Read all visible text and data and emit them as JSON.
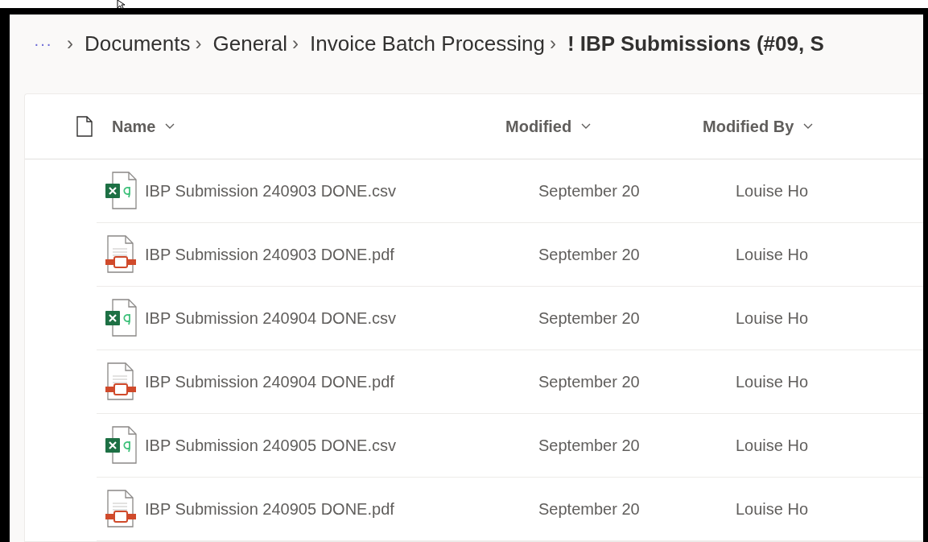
{
  "breadcrumb": {
    "overflow": "···",
    "separator": "›",
    "items": [
      {
        "label": "Documents",
        "current": false
      },
      {
        "label": "General",
        "current": false
      },
      {
        "label": "Invoice Batch Processing",
        "current": false
      },
      {
        "label": "! IBP Submissions (#09, S",
        "current": true
      }
    ]
  },
  "table": {
    "columns": [
      {
        "label": "Name"
      },
      {
        "label": "Modified"
      },
      {
        "label": "Modified By"
      }
    ],
    "rows": [
      {
        "kind": "csv",
        "name": "IBP Submission 240903 DONE.csv",
        "modified": "September 20",
        "modified_by": "Louise Ho"
      },
      {
        "kind": "pdf",
        "name": "IBP Submission 240903 DONE.pdf",
        "modified": "September 20",
        "modified_by": "Louise Ho"
      },
      {
        "kind": "csv",
        "name": "IBP Submission 240904 DONE.csv",
        "modified": "September 20",
        "modified_by": "Louise Ho"
      },
      {
        "kind": "pdf",
        "name": "IBP Submission 240904 DONE.pdf",
        "modified": "September 20",
        "modified_by": "Louise Ho"
      },
      {
        "kind": "csv",
        "name": "IBP Submission 240905 DONE.csv",
        "modified": "September 20",
        "modified_by": "Louise Ho"
      },
      {
        "kind": "pdf",
        "name": "IBP Submission 240905 DONE.pdf",
        "modified": "September 20",
        "modified_by": "Louise Ho"
      }
    ]
  }
}
